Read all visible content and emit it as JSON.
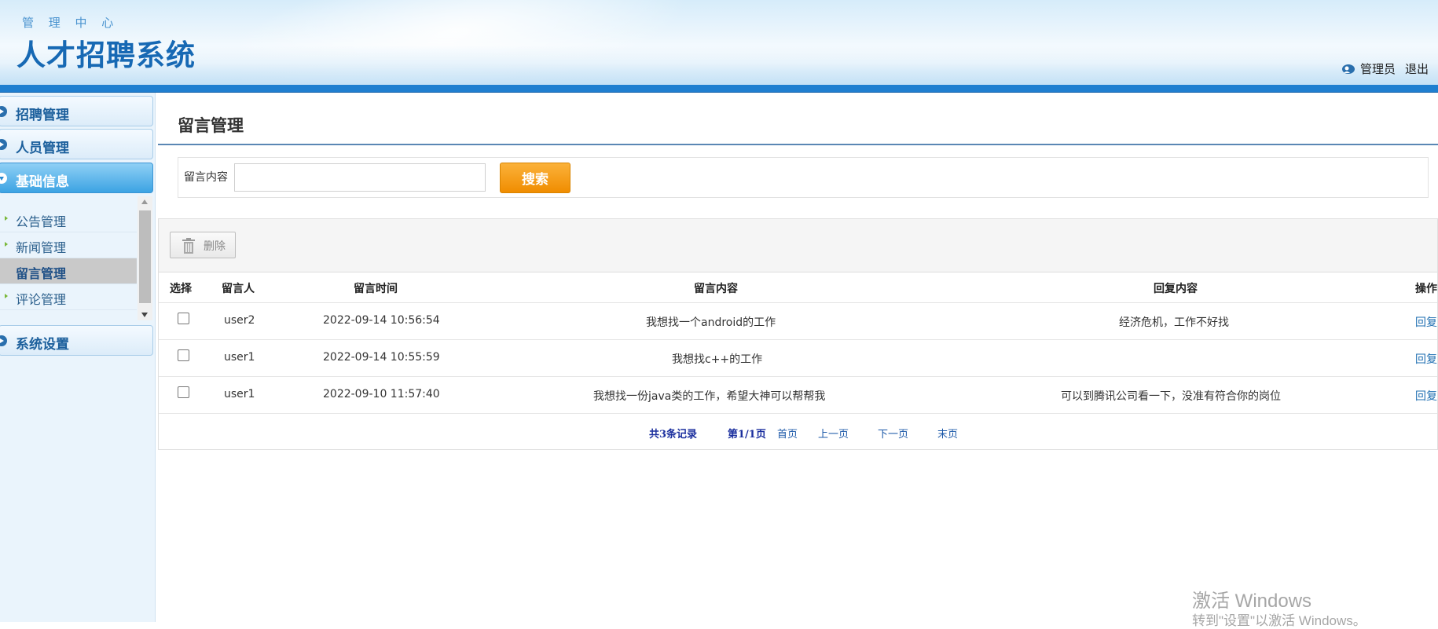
{
  "header": {
    "subtitle": "管 理 中 心",
    "title": "人才招聘系统",
    "user": "管理员",
    "logout": "退出"
  },
  "sidebar": {
    "menus": [
      {
        "label": "招聘管理"
      },
      {
        "label": "人员管理"
      },
      {
        "label": "基础信息"
      },
      {
        "label": "系统设置"
      }
    ],
    "submenu": [
      {
        "label": "公告管理"
      },
      {
        "label": "新闻管理"
      },
      {
        "label": "留言管理"
      },
      {
        "label": "评论管理"
      }
    ]
  },
  "main": {
    "title": "留言管理",
    "search": {
      "label": "留言内容",
      "value": "",
      "button": "搜索"
    },
    "toolbar": {
      "delete": "删除"
    },
    "columns": [
      "选择",
      "留言人",
      "留言时间",
      "留言内容",
      "回复内容",
      "操作"
    ],
    "rows": [
      {
        "user": "user2",
        "time": "2022-09-14 10:56:54",
        "content": "我想找一个android的工作",
        "reply": "经济危机，工作不好找",
        "action": "回复"
      },
      {
        "user": "user1",
        "time": "2022-09-14 10:55:59",
        "content": "我想找c++的工作",
        "reply": "",
        "action": "回复"
      },
      {
        "user": "user1",
        "time": "2022-09-10 11:57:40",
        "content": "我想找一份java类的工作，希望大神可以帮帮我",
        "reply": "可以到腾讯公司看一下，没准有符合你的岗位",
        "action": "回复"
      }
    ],
    "pager": {
      "total": "共3条记录",
      "page": "第1/1页",
      "first": "首页",
      "prev": "上一页",
      "next": "下一页",
      "last": "末页"
    }
  },
  "watermark": {
    "line1": "激活 Windows",
    "line2": "转到\"设置\"以激活 Windows。"
  },
  "colors": {
    "accent": "#1f7fd0",
    "search_button": "#f39a12",
    "link": "#1f6fb2"
  }
}
